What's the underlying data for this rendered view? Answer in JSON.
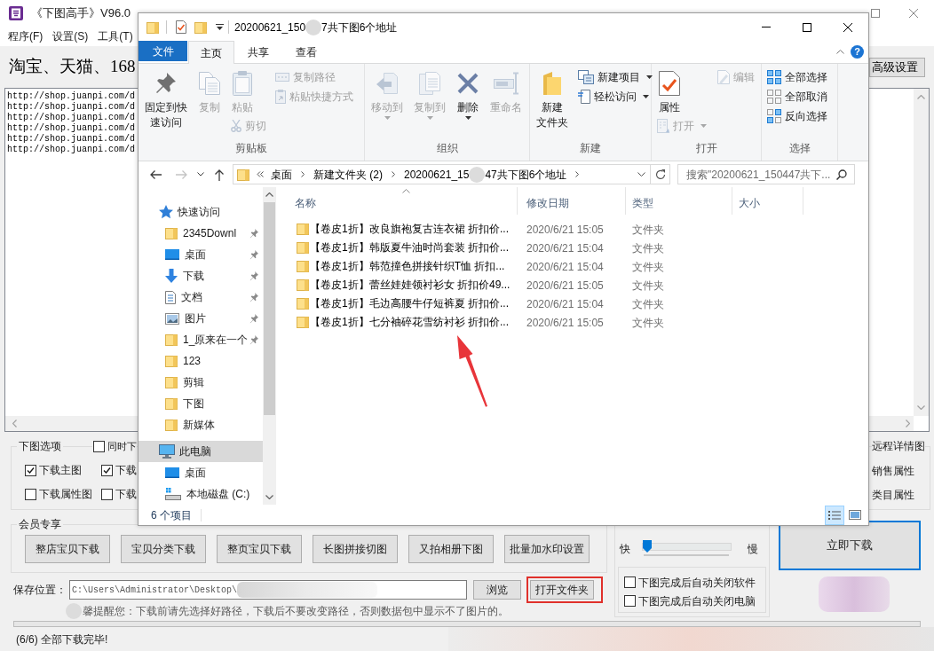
{
  "app_window": {
    "title": "《下图高手》V96.0",
    "menu": [
      "程序(F)",
      "设置(S)",
      "工具(T)"
    ],
    "heading": "淘宝、天猫、168",
    "advanced_settings_button": "高级设置",
    "url_lines": [
      "http://shop.juanpi.com/d",
      "http://shop.juanpi.com/d",
      "http://shop.juanpi.com/d",
      "http://shop.juanpi.com/d",
      "http://shop.juanpi.com/d",
      "http://shop.juanpi.com/d"
    ],
    "download_options": {
      "legend": "下图选项",
      "top_checkbox": {
        "label": "同时下",
        "checked": false
      },
      "checkboxes": [
        {
          "label": "下载主图",
          "checked": true
        },
        {
          "label": "下载",
          "checked": true
        },
        {
          "label": "下载属性图",
          "checked": false
        },
        {
          "label": "下载",
          "checked": false
        }
      ],
      "right_labels": [
        "远程详情图",
        "销售属性",
        "类目属性"
      ]
    },
    "member_features": {
      "legend": "会员专享",
      "buttons": [
        "整店宝贝下载",
        "宝贝分类下载",
        "整页宝贝下载",
        "长图拼接切图",
        "又拍相册下图",
        "批量加水印设置"
      ]
    },
    "speed_slider": {
      "fast_label": "快",
      "slow_label": "慢",
      "level": 0
    },
    "auto_close_options": [
      {
        "label": "下图完成后自动关闭软件",
        "checked": false
      },
      {
        "label": "下图完成后自动关闭电脑",
        "checked": false
      }
    ],
    "start_button": "立即下载",
    "save_location": {
      "label": "保存位置：",
      "value": "C:\\Users\\Administrator\\Desktop\\",
      "browse_button": "浏览",
      "open_folder_button": "打开文件夹"
    },
    "notice": "馨提醒您：下载前请先选择好路径，下载后不要改变路径，否则数据包中显示不了图片的。",
    "status": "(6/6) 全部下载完毕!"
  },
  "explorer_window": {
    "title_parts": [
      "20200621_150",
      "7共下图6个地址"
    ],
    "ribbon_tabs": [
      {
        "label": "文件",
        "kind": "file",
        "selected": false
      },
      {
        "label": "主页",
        "kind": "tab",
        "selected": true
      },
      {
        "label": "共享",
        "kind": "tab",
        "selected": false
      },
      {
        "label": "查看",
        "kind": "tab",
        "selected": false
      }
    ],
    "help_button": "?",
    "ribbon_groups": [
      {
        "label": "剪贴板",
        "commands": [
          {
            "label": "固定到快速访问",
            "kind": "large",
            "disabled": false,
            "dropdown": false
          },
          {
            "label": "复制",
            "kind": "large",
            "disabled": true,
            "dropdown": false
          },
          {
            "label": "粘贴",
            "kind": "large",
            "disabled": true,
            "dropdown": false
          },
          {
            "label": "剪切",
            "kind": "sub",
            "disabled": true,
            "dropdown": false
          },
          {
            "label": "复制路径",
            "kind": "small",
            "disabled": true,
            "dropdown": false
          },
          {
            "label": "粘贴快捷方式",
            "kind": "small",
            "disabled": true,
            "dropdown": false
          }
        ]
      },
      {
        "label": "组织",
        "commands": [
          {
            "label": "移动到",
            "kind": "large",
            "disabled": true,
            "dropdown": true
          },
          {
            "label": "复制到",
            "kind": "large",
            "disabled": true,
            "dropdown": true
          },
          {
            "label": "删除",
            "kind": "large",
            "disabled": false,
            "dropdown": true
          },
          {
            "label": "重命名",
            "kind": "large",
            "disabled": true,
            "dropdown": false
          }
        ]
      },
      {
        "label": "新建",
        "commands": [
          {
            "label": "新建文件夹",
            "kind": "large",
            "disabled": false,
            "dropdown": false
          },
          {
            "label": "新建项目",
            "kind": "small",
            "disabled": false,
            "dropdown": true
          },
          {
            "label": "轻松访问",
            "kind": "small",
            "disabled": false,
            "dropdown": true
          }
        ]
      },
      {
        "label": "打开",
        "commands": [
          {
            "label": "属性",
            "kind": "large",
            "disabled": false,
            "dropdown": false
          },
          {
            "label": "打开",
            "kind": "sub",
            "disabled": true,
            "dropdown": true
          },
          {
            "label": "编辑",
            "kind": "small",
            "disabled": true,
            "dropdown": false
          }
        ]
      },
      {
        "label": "选择",
        "commands": [
          {
            "label": "全部选择",
            "kind": "small",
            "disabled": false,
            "dropdown": false
          },
          {
            "label": "全部取消",
            "kind": "small",
            "disabled": false,
            "dropdown": false
          },
          {
            "label": "反向选择",
            "kind": "small",
            "disabled": false,
            "dropdown": false
          }
        ]
      }
    ],
    "nav_buttons": [
      {
        "kind": "back",
        "disabled": false
      },
      {
        "kind": "forward",
        "disabled": true
      },
      {
        "kind": "recent",
        "disabled": false
      },
      {
        "kind": "up",
        "disabled": false
      }
    ],
    "address_crumbs": [
      {
        "parts": [
          "桌面"
        ]
      },
      {
        "parts": [
          "新建文件夹 (2)"
        ]
      },
      {
        "parts": [
          "20200621_15",
          "47共下图6个地址"
        ]
      }
    ],
    "search": {
      "placeholder": "搜索\"20200621_150447共下..."
    },
    "nav_tree": [
      {
        "label": "快速访问",
        "kind": "quick_access",
        "selected": false,
        "children": [
          {
            "label": "2345Downl",
            "kind": "folder",
            "pinned": true,
            "selected": false
          },
          {
            "label": "桌面",
            "kind": "desktop",
            "pinned": true,
            "selected": false
          },
          {
            "label": "下载",
            "kind": "downloads",
            "pinned": true,
            "selected": false
          },
          {
            "label": "文档",
            "kind": "documents",
            "pinned": true,
            "selected": false
          },
          {
            "label": "图片",
            "kind": "pictures",
            "pinned": true,
            "selected": false
          },
          {
            "label": "1_原来在一个",
            "kind": "folder",
            "pinned": true,
            "selected": false
          },
          {
            "label": "123",
            "kind": "folder",
            "pinned": false,
            "selected": false
          },
          {
            "label": "剪辑",
            "kind": "folder",
            "pinned": false,
            "selected": false
          },
          {
            "label": "下图",
            "kind": "folder",
            "pinned": false,
            "selected": false
          },
          {
            "label": "新媒体",
            "kind": "folder",
            "pinned": false,
            "selected": false
          }
        ]
      },
      {
        "label": "此电脑",
        "kind": "this_pc",
        "selected": true,
        "children": [
          {
            "label": "桌面",
            "kind": "desktop",
            "selected": false
          },
          {
            "label": "本地磁盘 (C:)",
            "kind": "drive",
            "selected": false
          }
        ]
      }
    ],
    "file_columns": [
      "名称",
      "修改日期",
      "类型",
      "大小"
    ],
    "files": [
      {
        "name": "【卷皮1折】改良旗袍复古连衣裙 折扣价...",
        "modified": "2020/6/21 15:05",
        "type": "文件夹"
      },
      {
        "name": "【卷皮1折】韩版夏牛油时尚套装 折扣价...",
        "modified": "2020/6/21 15:04",
        "type": "文件夹"
      },
      {
        "name": "【卷皮1折】韩范撞色拼接针织T恤 折扣...",
        "modified": "2020/6/21 15:04",
        "type": "文件夹"
      },
      {
        "name": "【卷皮1折】蕾丝娃娃领衬衫女 折扣价49...",
        "modified": "2020/6/21 15:05",
        "type": "文件夹"
      },
      {
        "name": "【卷皮1折】毛边高腰牛仔短裤夏 折扣价...",
        "modified": "2020/6/21 15:04",
        "type": "文件夹"
      },
      {
        "name": "【卷皮1折】七分袖碎花雪纺衬衫 折扣价...",
        "modified": "2020/6/21 15:05",
        "type": "文件夹"
      }
    ],
    "status": "6 个项目",
    "view_modes": [
      {
        "kind": "details",
        "selected": true
      },
      {
        "kind": "large_icons",
        "selected": false
      }
    ]
  }
}
